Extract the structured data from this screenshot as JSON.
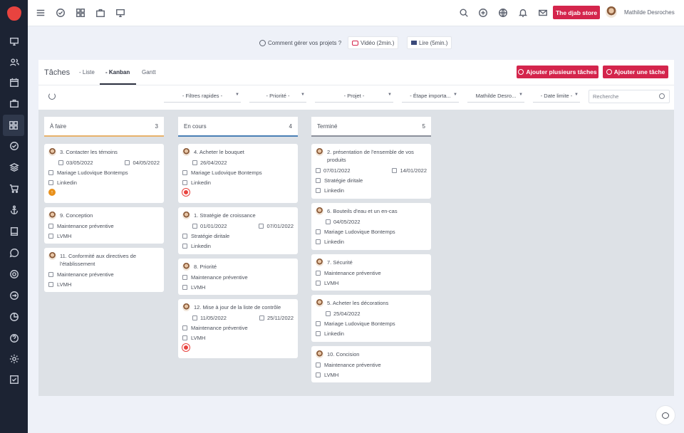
{
  "topbar": {
    "store_button": "The djab store",
    "user_name": "Mathilde Desroches"
  },
  "help": {
    "question": "Comment gérer vos projets ?",
    "video": "Vidéo (2min.)",
    "read": "Lire (5min.)"
  },
  "header": {
    "title": "Tâches",
    "tabs": [
      "- Liste",
      "- Kanban",
      "Gantt"
    ],
    "add_many": "Ajouter plusieurs tâches",
    "add_one": "Ajouter une tâche"
  },
  "filters": [
    "- Filtres rapides -",
    "- Priorité -",
    "- Projet -",
    "- Étape importa...",
    "Mathilde Desro...",
    "- Date limite -"
  ],
  "search_placeholder": "Recherche",
  "colors": {
    "accent": "#d4254c",
    "sidebar": "#1c2333",
    "todo": "#e8b26b",
    "inprogress": "#4a7fb5",
    "done": "#8b909b",
    "orange_badge": "#e8901a",
    "red_badge": "#e8433f"
  },
  "columns": [
    {
      "title": "À faire",
      "count": "3",
      "cards": [
        {
          "title": "3. Contacter les témoins",
          "start": "03/05/2022",
          "end": "04/05/2022",
          "project": "Mariage Ludovique Bontemps",
          "client": "Linkedin",
          "badge": "up"
        },
        {
          "title": "9. Conception",
          "project": "Maintenance préventive",
          "client": "LVMH"
        },
        {
          "title": "11. Conformité aux directives de l'établissement",
          "project": "Maintenance préventive",
          "client": "LVMH"
        }
      ]
    },
    {
      "title": "En cours",
      "count": "4",
      "cards": [
        {
          "title": "4. Acheter le bouquet",
          "date": "26/04/2022",
          "project": "Mariage Ludovique Bontemps",
          "client": "Linkedin",
          "badge": "target"
        },
        {
          "title": "1. Stratégie de croissance",
          "start": "01/01/2022",
          "end": "07/01/2022",
          "project": "Stratégie diritale",
          "client": "Linkedin"
        },
        {
          "title": "8. Priorité",
          "project": "Maintenance préventive",
          "client": "LVMH"
        },
        {
          "title": "12. Mise à jour de la liste de contrôle",
          "start": "11/05/2022",
          "end": "25/11/2022",
          "project": "Maintenance préventive",
          "client": "LVMH",
          "badge": "target"
        }
      ]
    },
    {
      "title": "Terminé",
      "count": "5",
      "cards": [
        {
          "title": "2. présentation de l'ensemble de vos produits",
          "start": "07/01/2022",
          "end": "14/01/2022",
          "project": "Stratégie diritale",
          "client": "Linkedin"
        },
        {
          "title": "6. Bouteils d'eau et un en-cas",
          "date": "04/05/2022",
          "project": "Mariage Ludovique Bontemps",
          "client": "Linkedin"
        },
        {
          "title": "7. Sécurité",
          "project": "Maintenance préventive",
          "client": "LVMH"
        },
        {
          "title": "5. Acheter les décorations",
          "date": "25/04/2022",
          "project": "Mariage Ludovique Bontemps",
          "client": "Linkedin"
        },
        {
          "title": "10. Concision",
          "project": "Maintenance préventive",
          "client": "LVMH"
        }
      ]
    }
  ]
}
